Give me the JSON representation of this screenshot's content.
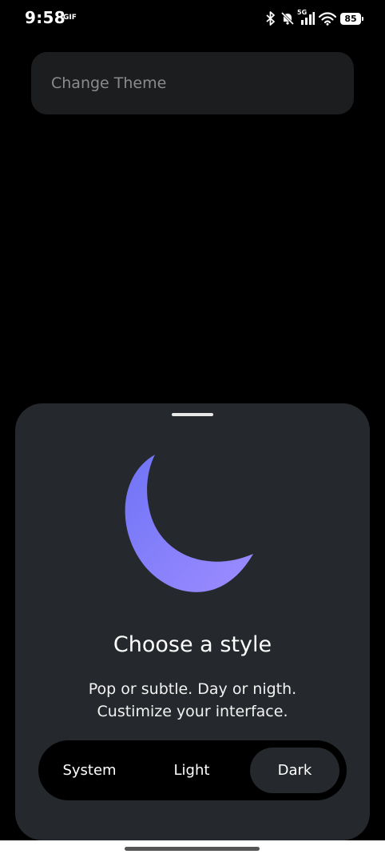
{
  "status_bar": {
    "time": "9:58",
    "gif_badge": "GIF",
    "network_label": "5G",
    "battery_level": "85",
    "icons": [
      "bluetooth-icon",
      "bell-muted-icon",
      "signal-icon",
      "wifi-icon",
      "battery-icon"
    ]
  },
  "page": {
    "theme_card_label": "Change Theme"
  },
  "sheet": {
    "title": "Choose a style",
    "description_line1": "Pop or subtle. Day or nigth.",
    "description_line2": "Custimize your interface.",
    "illustration": "moon-icon",
    "accent_color": "#8a7cff",
    "options": [
      {
        "label": "System",
        "selected": false
      },
      {
        "label": "Light",
        "selected": false
      },
      {
        "label": "Dark",
        "selected": true
      }
    ]
  }
}
